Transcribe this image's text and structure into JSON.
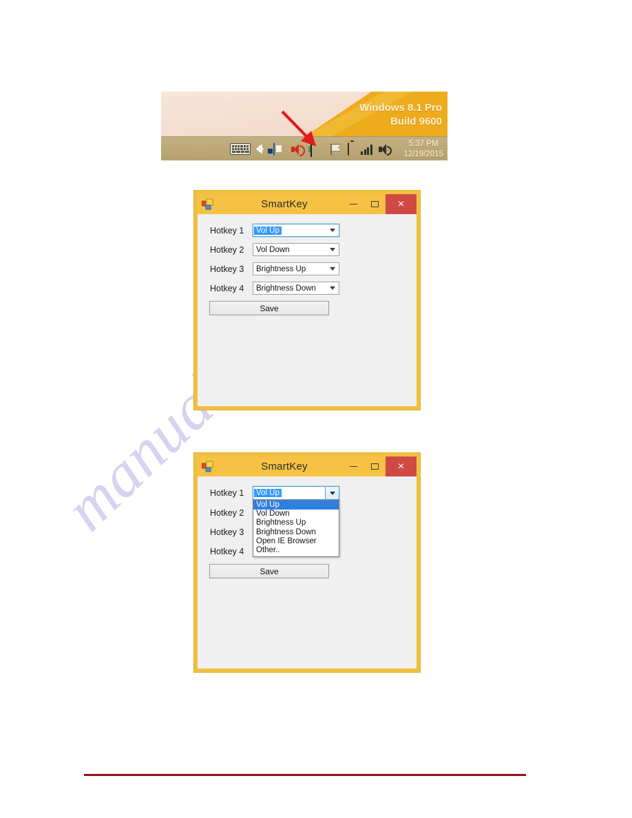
{
  "desktop": {
    "os_line1": "Windows 8.1 Pro",
    "os_line2": "Build 9600",
    "clock_time": "5:37 PM",
    "clock_date": "12/19/2015",
    "tray_icons": [
      "keyboard-icon",
      "bluetooth-icon",
      "network-app-icon",
      "speaker-muted-icon",
      "smartkey-tray-icon",
      "flag-icon",
      "battery-icon",
      "signal-bars-icon",
      "volume-icon"
    ],
    "annotation": "red-arrow-pointing-to-smartkey-tray-icon",
    "colors": {
      "taskbar": "#bda878",
      "wallpaper": "#f4ded0",
      "accent_orange": "#eeac1c",
      "arrow": "#e11b1b"
    }
  },
  "window1": {
    "title": "SmartKey",
    "app_icon": "winforms-app-icon",
    "minimize_label": "–",
    "maximize_label": "☐",
    "close_label": "×",
    "rows": [
      {
        "label": "Hotkey 1",
        "value": "Vol Up",
        "focused": true
      },
      {
        "label": "Hotkey 2",
        "value": "Vol Down",
        "focused": false
      },
      {
        "label": "Hotkey 3",
        "value": "Brightness Up",
        "focused": false
      },
      {
        "label": "Hotkey 4",
        "value": "Brightness Down",
        "focused": false
      }
    ],
    "save_label": "Save",
    "colors": {
      "frame": "#f0c040",
      "titlebar": "#f5c243",
      "close": "#d04a45"
    }
  },
  "window2": {
    "title": "SmartKey",
    "app_icon": "winforms-app-icon",
    "minimize_label": "–",
    "maximize_label": "☐",
    "close_label": "×",
    "rows": [
      {
        "label": "Hotkey 1",
        "value": "Vol Up",
        "focused": true
      },
      {
        "label": "Hotkey 2",
        "value": "",
        "focused": false
      },
      {
        "label": "Hotkey 3",
        "value": "",
        "focused": false
      },
      {
        "label": "Hotkey 4",
        "value": "",
        "focused": false
      }
    ],
    "save_label": "Save",
    "dropdown": {
      "open": true,
      "selected": "Vol Up",
      "options": [
        "Vol Up",
        "Vol Down",
        "Brightness Up",
        "Brightness Down",
        "Open IE Browser",
        "Other.."
      ]
    },
    "colors": {
      "frame": "#f0c040",
      "titlebar": "#f5c243",
      "close": "#d04a45",
      "highlight": "#2f7fe0"
    }
  },
  "watermark": {
    "text": "manualshive.com",
    "color": "#c9c4ea"
  },
  "page": {
    "rule_color": "#961116"
  }
}
